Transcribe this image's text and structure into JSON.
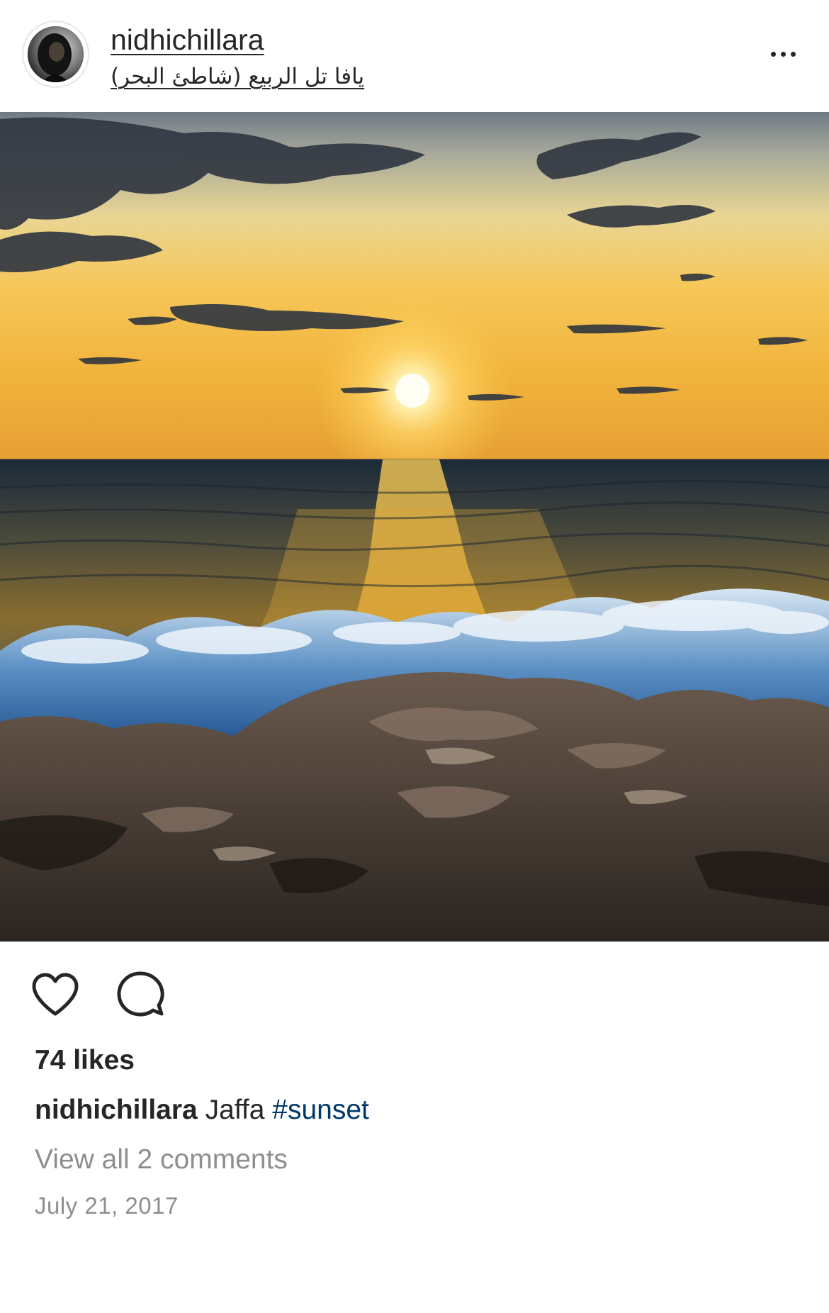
{
  "post": {
    "username": "nidhichillara",
    "location": "يافا تل الربيع (شاطئ البحر)",
    "more_icon": "more-horizontal-icon",
    "photo_subject": "sunset-over-sea",
    "actions": {
      "like_icon": "heart-icon",
      "comment_icon": "comment-icon"
    },
    "likes_text": "74 likes",
    "caption": {
      "username": "nidhichillara",
      "text": "Jaffa",
      "hashtag": "#sunset"
    },
    "view_comments_text": "View all 2 comments",
    "date": "July 21, 2017"
  },
  "colors": {
    "text": "#262626",
    "secondary_text": "#8e8e8e",
    "hashtag": "#00376b",
    "background": "#ffffff"
  }
}
